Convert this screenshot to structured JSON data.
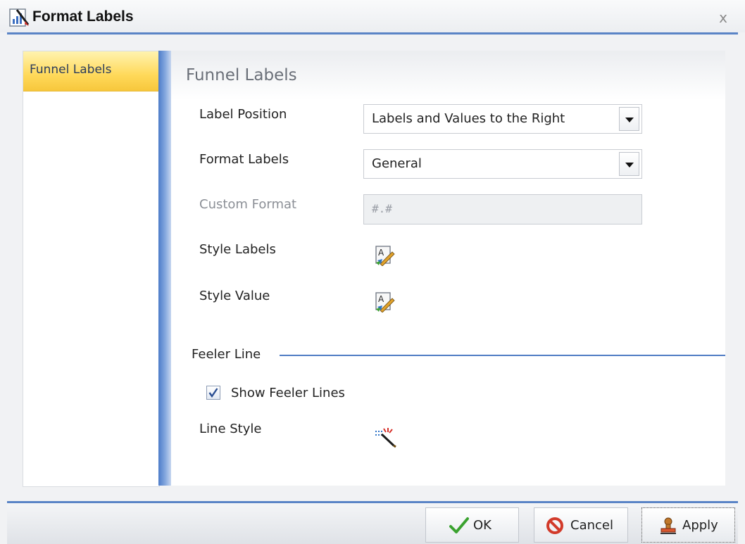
{
  "window": {
    "title": "Format Labels",
    "close_glyph": "x",
    "app_icon": "chart-format-icon"
  },
  "nav": {
    "items": [
      {
        "label": "Funnel Labels",
        "selected": true
      }
    ]
  },
  "panel": {
    "title": "Funnel Labels",
    "label_position": {
      "label": "Label Position",
      "value": "Labels and Values to the Right"
    },
    "format_labels": {
      "label": "Format Labels",
      "value": "General"
    },
    "custom_format": {
      "label": "Custom Format",
      "value": "#.#",
      "enabled": false
    },
    "style_labels": {
      "label": "Style Labels",
      "icon": "style-text-icon"
    },
    "style_value": {
      "label": "Style Value",
      "icon": "style-text-icon"
    },
    "feeler_line": {
      "section_title": "Feeler Line",
      "show_feeler_lines": {
        "label": "Show Feeler Lines",
        "checked": true
      },
      "line_style": {
        "label": "Line Style",
        "icon": "line-style-icon"
      }
    }
  },
  "footer": {
    "ok_label": "OK",
    "cancel_label": "Cancel",
    "apply_label": "Apply"
  },
  "colors": {
    "accent_blue": "#5a84c6",
    "selected_item": "#ffd95a",
    "ok_check": "#3aa22f",
    "cancel_red": "#d23a2a"
  }
}
